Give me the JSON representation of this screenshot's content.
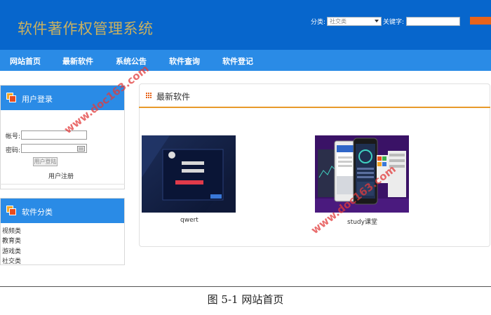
{
  "header": {
    "site_title": "软件著作权管理系统",
    "category_label": "分类:",
    "category_value": "社交类",
    "keyword_label": "关键字:"
  },
  "nav": {
    "items": [
      "网站首页",
      "最新软件",
      "系统公告",
      "软件查询",
      "软件登记"
    ]
  },
  "login_panel": {
    "title": "用户登录",
    "account_label": "帐号:",
    "password_label": "密码:",
    "login_button": "用户登陆",
    "register_link": "用户注册"
  },
  "category_panel": {
    "title": "软件分类",
    "items": [
      "视频类",
      "教育类",
      "游戏类",
      "社交类"
    ]
  },
  "main": {
    "title": "最新软件",
    "software": [
      {
        "name": "qwert"
      },
      {
        "name": "study课堂"
      }
    ]
  },
  "watermark": "www.doc163.com",
  "figure_caption": "图 5-1 网站首页",
  "colors": {
    "header_bg": "#0766cc",
    "nav_bg": "#2a8be6",
    "title_gold": "#c9b160",
    "accent_orange": "#e8631a"
  }
}
